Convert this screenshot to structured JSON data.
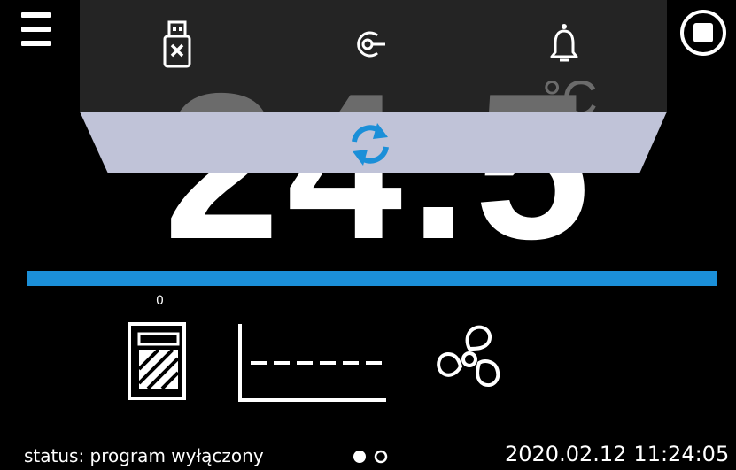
{
  "display": {
    "temperature": "24.5",
    "unit": "°C"
  },
  "indicator": {
    "zero_label": "0"
  },
  "top_panel": {
    "icons": [
      "usb-drive-icon",
      "key-lock-icon",
      "bell-icon"
    ],
    "sync_icon": "sync-icon"
  },
  "colors": {
    "accent_blue": "#1b8fd8",
    "panel_gray": "#c0c3d8",
    "background": "#000000"
  },
  "status_bar": {
    "status_text": "status: program wyłączony",
    "date": "2020.02.12",
    "time": "11:24:05",
    "page_count": 2,
    "active_page": 1
  },
  "progress": 1.0
}
